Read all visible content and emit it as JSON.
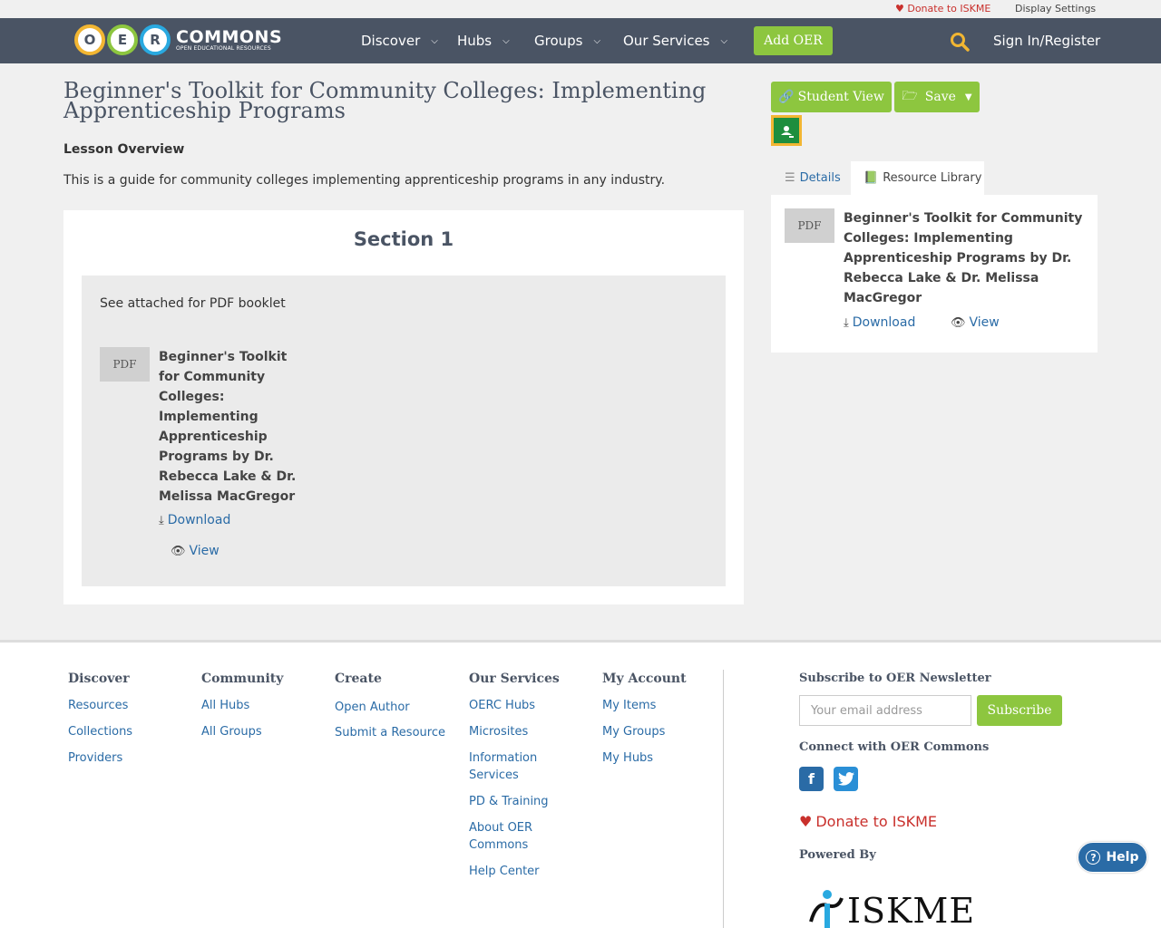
{
  "utility": {
    "donate": "Donate to ISKME",
    "display_settings": "Display Settings"
  },
  "brand": {
    "letters": [
      "O",
      "E",
      "R"
    ],
    "wordmark": "COMMONS",
    "tagline": "OPEN EDUCATIONAL RESOURCES"
  },
  "nav": {
    "items": [
      "Discover",
      "Hubs",
      "Groups",
      "Our Services"
    ],
    "add_oer": "Add OER",
    "signin": "Sign In/Register"
  },
  "page": {
    "title": "Beginner's Toolkit for Community Colleges: Implementing Apprenticeship Programs",
    "overview_heading": "Lesson Overview",
    "overview_text": "This is a guide for community colleges implementing apprenticeship programs in any industry."
  },
  "section": {
    "heading": "Section 1",
    "note": "See attached for PDF booklet",
    "resource": {
      "badge": "PDF",
      "title_lines": [
        "Beginner's Toolkit",
        "for Community",
        "Colleges:",
        "Implementing",
        "Apprenticeship",
        "Programs by Dr.",
        "Rebecca Lake & Dr.",
        "Melissa MacGregor"
      ],
      "download": "Download",
      "view": "View"
    }
  },
  "sidebar": {
    "student_view": "Student View",
    "save": "Save",
    "tabs": {
      "details": "Details",
      "library": "Resource Library"
    },
    "resource": {
      "badge": "PDF",
      "title_lines": [
        "Beginner's Toolkit for Community",
        "Colleges: Implementing",
        "Apprenticeship Programs by Dr.",
        "Rebecca Lake & Dr. Melissa",
        "MacGregor"
      ],
      "download": "Download",
      "view": "View"
    }
  },
  "footer": {
    "columns": [
      {
        "heading": "Discover",
        "links": [
          "Resources",
          "Collections",
          "Providers"
        ]
      },
      {
        "heading": "Community",
        "links": [
          "All Hubs",
          "All Groups"
        ]
      },
      {
        "heading": "Create",
        "links": [
          "Open Author",
          "Submit a Resource"
        ]
      },
      {
        "heading": "Our Services",
        "links": [
          "OERC Hubs",
          "Microsites",
          "Information Services",
          "PD & Training",
          "About OER Commons",
          "Help Center"
        ]
      },
      {
        "heading": "My Account",
        "links": [
          "My Items",
          "My Groups",
          "My Hubs"
        ]
      }
    ],
    "newsletter_heading": "Subscribe to OER Newsletter",
    "email_placeholder": "Your email address",
    "subscribe": "Subscribe",
    "connect_heading": "Connect with OER Commons",
    "donate": "Donate to ISKME",
    "powered_by": "Powered By",
    "iskme": "ISKME"
  },
  "help": "Help",
  "colors": {
    "nav_bg": "#4a5464",
    "accent_green": "#8dc63f",
    "link_blue": "#2a6ba6",
    "donate_red": "#c9302c"
  }
}
